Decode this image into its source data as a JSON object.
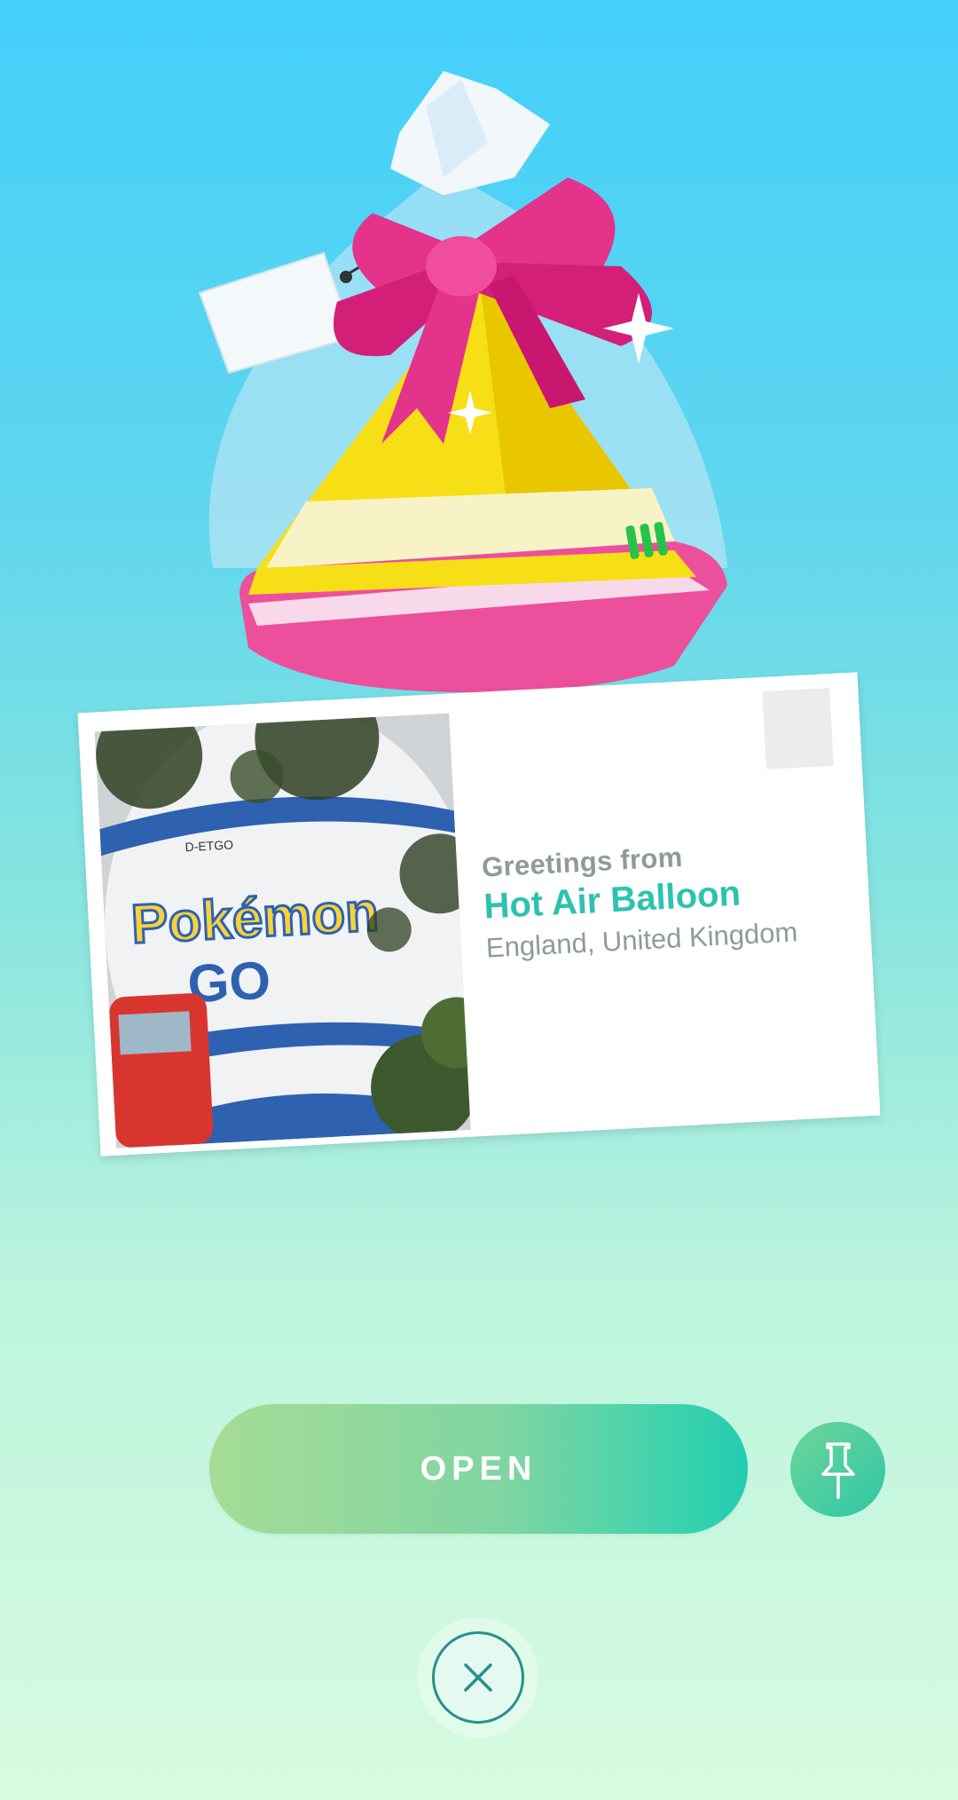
{
  "postcard": {
    "greeting": "Greetings from",
    "place_name": "Hot Air Balloon",
    "region": "England, United Kingdom",
    "photo_text": {
      "logo_line1": "Pokémon",
      "logo_line2": "GO",
      "registration": "D-ETGO"
    }
  },
  "actions": {
    "open_label": "OPEN",
    "pin_icon": "pushpin-icon",
    "close_icon": "close-icon"
  },
  "gift": {
    "icon": "gift-icon",
    "colors": {
      "bow": "#e3338a",
      "box": "#f7df17",
      "band": "#f8f3c7",
      "base": "#f26fb0"
    }
  }
}
